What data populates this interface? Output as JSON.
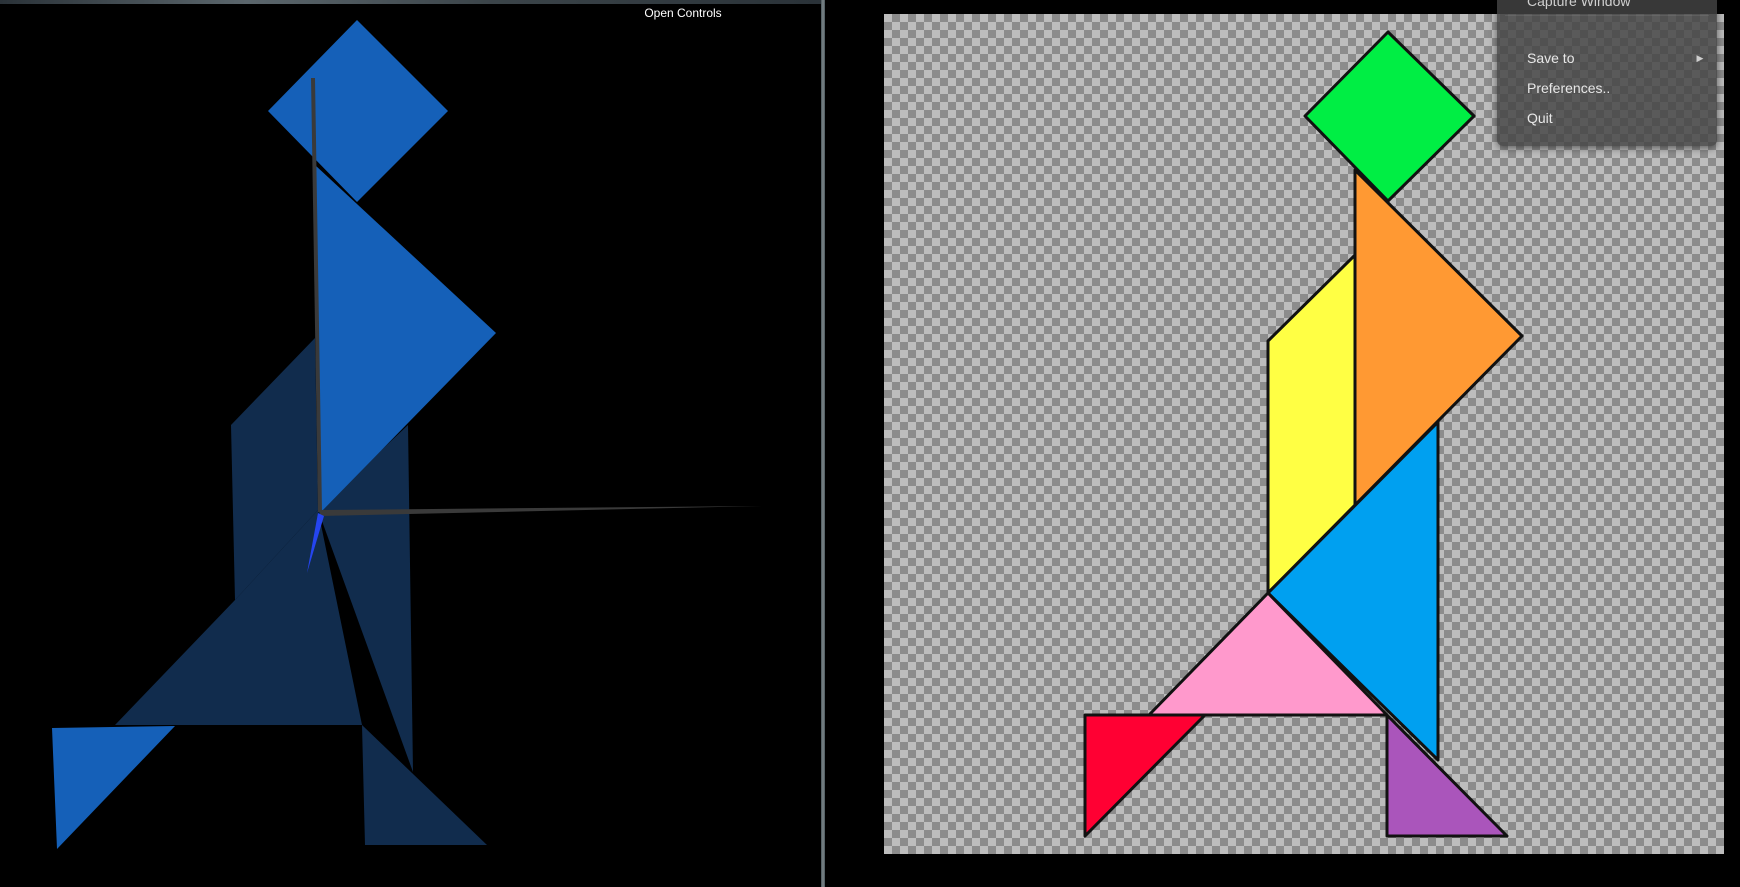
{
  "left_view": {
    "controls_label": "Open Controls",
    "colors": {
      "background": "#000000",
      "piece_front": "#1560b8",
      "piece_back": "#112c4d",
      "axis": "#3a3a3a",
      "axis_z": "#2545f0"
    }
  },
  "tangram": {
    "outline_color": "#111111",
    "pieces": [
      {
        "name": "square",
        "color": "#00ee44"
      },
      {
        "name": "large-triangle-top",
        "color": "#ff9933"
      },
      {
        "name": "parallelogram",
        "color": "#ffff44"
      },
      {
        "name": "large-triangle-middle",
        "color": "#00a0f0"
      },
      {
        "name": "medium-triangle",
        "color": "#ff99cc"
      },
      {
        "name": "small-triangle-left",
        "color": "#ff0033"
      },
      {
        "name": "small-triangle-right",
        "color": "#aa55bb"
      }
    ]
  },
  "context_menu": {
    "items": [
      {
        "label": "Capture Window",
        "has_submenu": false
      },
      {
        "label": "Save to",
        "has_submenu": true
      },
      {
        "label": "Preferences..",
        "has_submenu": false
      },
      {
        "label": "Quit",
        "has_submenu": false
      }
    ]
  }
}
